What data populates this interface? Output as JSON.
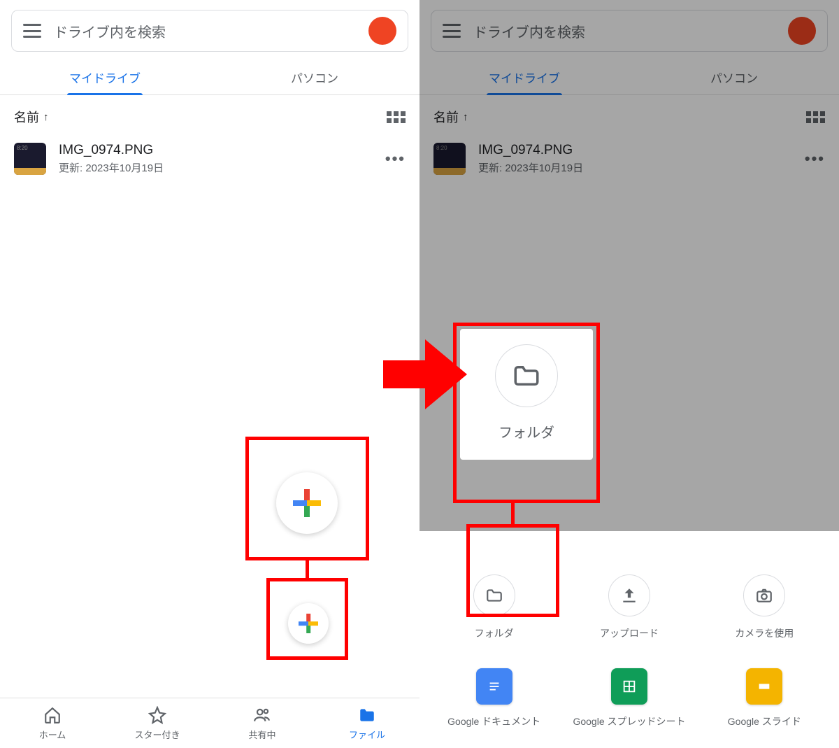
{
  "search": {
    "placeholder": "ドライブ内を検索"
  },
  "tabs": {
    "mydrive": "マイドライブ",
    "computer": "パソコン"
  },
  "sort": {
    "label": "名前",
    "arrow": "↑"
  },
  "file": {
    "name": "IMG_0974.PNG",
    "subtitle": "更新: 2023年10月19日"
  },
  "bottomnav": {
    "home": "ホーム",
    "starred": "スター付き",
    "shared": "共有中",
    "files": "ファイル"
  },
  "create_callout": {
    "label": "フォルダ"
  },
  "create_sheet": {
    "folder": "フォルダ",
    "upload": "アップロード",
    "camera": "カメラを使用",
    "docs": "Google ドキュメント",
    "sheets": "Google スプレッドシート",
    "slides": "Google スライド"
  }
}
